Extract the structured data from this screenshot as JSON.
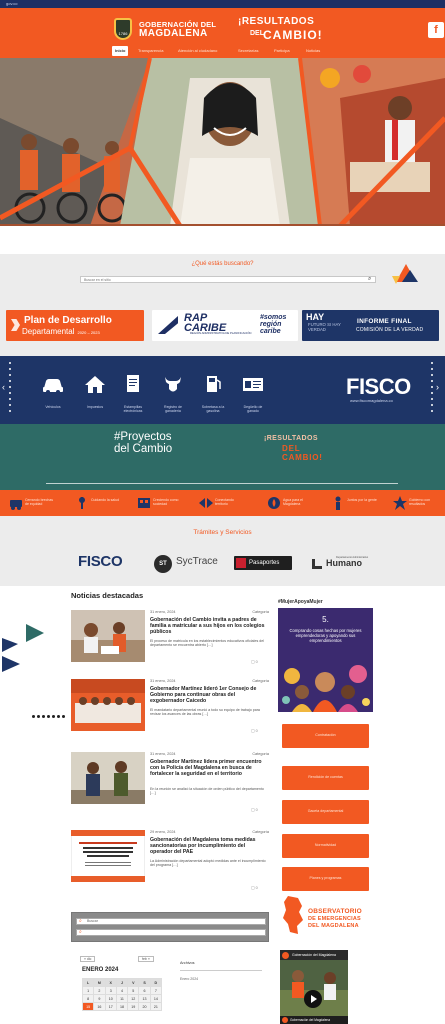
{
  "topbar": {
    "link": "gov.co"
  },
  "header": {
    "brand_line1": "GOBERNACIÓN DEL",
    "brand_line2": "MAGDALENA",
    "crest_year": "1786",
    "slogan_line1": "¡RESULTADOS",
    "slogan_del": "DEL",
    "slogan_line2": "CAMBIO!",
    "corner_button": "f",
    "nav": [
      "Inicio",
      "Transparencia",
      "Atención al ciudadano",
      "Secretarías",
      "Participa",
      "Noticias"
    ]
  },
  "search": {
    "title": "¿Qué estás buscando?",
    "placeholder": "Buscar en el sitio"
  },
  "banners": {
    "plan_line1": "Plan de Desarrollo",
    "plan_line2": "Departamental",
    "plan_years": "2020 – 2023",
    "rap_title": "RAP CARIBE",
    "rap_sub": "REGIÓN ADMINISTRATIVA DE PLANIFICACIÓN",
    "rap_hashtag": "#somos región caribe",
    "verdad_hay": "HAY",
    "verdad_future": "FUTURO SI HAY VERDAD",
    "verdad_line1": "INFORME FINAL",
    "verdad_line2": "COMISIÓN DE LA VERDAD"
  },
  "services": {
    "items": [
      {
        "label": "Vehículos",
        "icon": "car-icon"
      },
      {
        "label": "Impuestos",
        "icon": "house-icon"
      },
      {
        "label": "Estampillas electrónicas",
        "icon": "document-icon"
      },
      {
        "label": "Registro de ganadería",
        "icon": "bull-icon"
      },
      {
        "label": "Sobretasa a la gasolina",
        "icon": "fuel-pump-icon"
      },
      {
        "label": "Degüello de ganado",
        "icon": "tax-document-icon"
      }
    ],
    "fisco_logo": "FISCO",
    "fisco_url": "www.fiscomagdalena.co",
    "arrow_left": "‹",
    "arrow_right": "›"
  },
  "proyectos": {
    "title_line1": "#Proyectos",
    "title_line2": "del Cambio",
    "slogan_line1": "¡RESULTADOS",
    "slogan_line2": "DEL CAMBIO!"
  },
  "sectors": [
    {
      "label": "Cerrando brechas de equidad",
      "icon": "road-icon"
    },
    {
      "label": "Cuidando la salud",
      "icon": "health-icon"
    },
    {
      "label": "Creciendo como sociedad",
      "icon": "society-icon"
    },
    {
      "label": "Conectando territorio",
      "icon": "connect-icon"
    },
    {
      "label": "Agua para el Magdalena",
      "icon": "water-icon"
    },
    {
      "label": "Juntos por la gente",
      "icon": "people-icon"
    },
    {
      "label": "Gobierno con resultados",
      "icon": "star-icon"
    }
  ],
  "tramites": {
    "title": "Trámites y Servicios",
    "fisco": "FISCO",
    "sytrace": "SycTrace",
    "sytrace_badge": "ST",
    "pasaportes": "Pasaportes",
    "humano": "Humano",
    "humano_small": "Departamento Administrativo"
  },
  "news": {
    "heading": "Noticias destacadas",
    "items": [
      {
        "date": "31 enero, 2024",
        "category": "Categoría",
        "title": "Gobernación del Cambio invita a padres de familia a matricular a sus hijos en los colegios públicos",
        "excerpt": "El proceso de matrícula en los establecimientos educativos oficiales del departamento se encuentra abierto […]",
        "comments": "0"
      },
      {
        "date": "31 enero, 2024",
        "category": "Categoría",
        "title": "Gobernador Martínez lideró 1er Consejo de Gobierno para continuar obras del exgobernador Caicedo",
        "excerpt": "El mandatario departamental reunió a todo su equipo de trabajo para revisar los avances de las obras […]",
        "comments": "0"
      },
      {
        "date": "31 enero, 2024",
        "category": "Categoría",
        "title": "Gobernador Martínez lidera primer encuentro con la Policía del Magdalena en busca de fortalecer la seguridad en el territorio",
        "excerpt": "En la reunión se analizó la situación de orden público del departamento […]",
        "comments": "0"
      },
      {
        "date": "29 enero, 2024",
        "category": "Categoría",
        "title": "Gobernación del Magdalena toma medidas sancionatorias por incumplimiento del operador del PAE",
        "excerpt": "La Administración departamental adoptó medidas ante el incumplimiento del programa […]",
        "comments": "0"
      }
    ]
  },
  "widgets": {
    "search_placeholder": "Buscar",
    "calendar_prev": "« dic",
    "calendar_next": "feb »",
    "calendar_month": "ENERO 2024",
    "calendar_days": [
      "L",
      "M",
      "X",
      "J",
      "V",
      "S",
      "D"
    ],
    "calendar_rows": [
      [
        "1",
        "2",
        "3",
        "4",
        "5",
        "6",
        "7"
      ],
      [
        "8",
        "9",
        "10",
        "11",
        "12",
        "13",
        "14"
      ],
      [
        "15",
        "16",
        "17",
        "18",
        "19",
        "20",
        "21"
      ]
    ],
    "small_title": "Archivos",
    "small_sub": "Enero 2024"
  },
  "sidebar": {
    "hashtag": "#MujerApoyaMujer",
    "campaign_number": "5.",
    "campaign_text": "Comprando cosas hechas por mujeres emprendedoras y apoyando sus emprendimientos",
    "buttons": [
      "Contratación",
      "Rendición de cuentas",
      "Gaceta departamental",
      "Normatividad",
      "Planes y programas"
    ],
    "observatorio_line1": "OBSERVATORIO",
    "observatorio_line2": "DE EMERGENCIAS",
    "observatorio_line3": "DEL MAGDALENA",
    "video_title": "Gobernación del Magdalena",
    "video_caption": "Gobernación del Magdalena"
  },
  "colors": {
    "accent": "#f25922",
    "navy": "#1e3567",
    "teal": "#2e6b66"
  }
}
